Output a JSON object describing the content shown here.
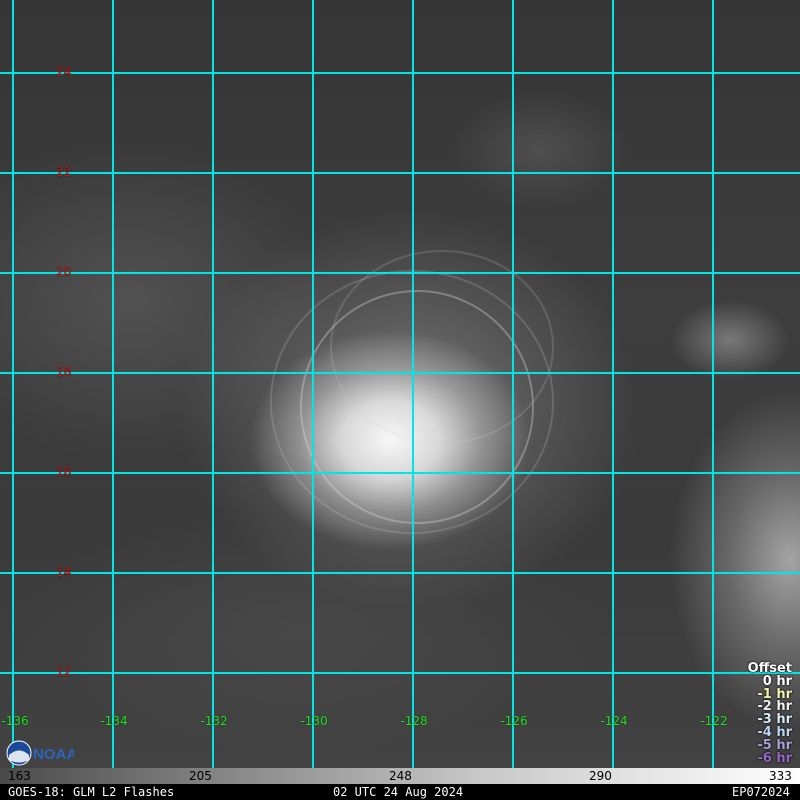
{
  "grid": {
    "line_color": "#00e5e5",
    "latitudes": [
      "24",
      "22",
      "20",
      "18",
      "16",
      "14",
      "12"
    ],
    "longitudes": [
      "-136",
      "-134",
      "-132",
      "-130",
      "-128",
      "-126",
      "-124",
      "-122"
    ],
    "lat_label_color": "#c81414",
    "lon_label_color": "#22e622"
  },
  "offset_legend": {
    "title": "Offset",
    "entries": [
      {
        "label": "0 hr",
        "color": "#ffffff"
      },
      {
        "label": "-1 hr",
        "color": "#f4f4b0"
      },
      {
        "label": "-2 hr",
        "color": "#f0f0f0"
      },
      {
        "label": "-3 hr",
        "color": "#d8ecf5"
      },
      {
        "label": "-4 hr",
        "color": "#bcd4f0"
      },
      {
        "label": "-5 hr",
        "color": "#a9a0dc"
      },
      {
        "label": "-6 hr",
        "color": "#9468c8"
      }
    ]
  },
  "colorbar": {
    "ticks": [
      "163",
      "205",
      "248",
      "290",
      "333"
    ]
  },
  "footer": {
    "left": "GOES-18: GLM L2 Flashes",
    "center": "02 UTC 24 Aug 2024",
    "right": "EP072024"
  },
  "logo": {
    "icon": "noaa-logo",
    "text": "NOAA"
  }
}
